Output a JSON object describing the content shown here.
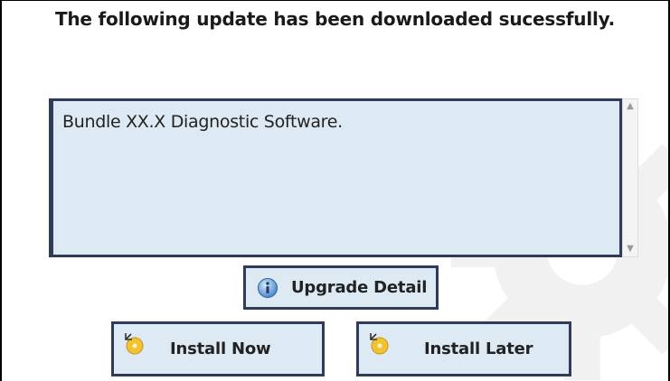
{
  "dialog": {
    "heading": "The following update has been downloaded sucessfully.",
    "update_list": {
      "content": "Bundle XX.X Diagnostic Software."
    },
    "buttons": {
      "upgrade_detail": "Upgrade Detail",
      "install_now": "Install Now",
      "install_later": "Install Later"
    },
    "icons": {
      "upgrade_detail": "info-icon",
      "install_now": "install-disk-icon",
      "install_later": "install-disk-icon",
      "background": "gear-icon"
    },
    "colors": {
      "panel_fill": "#dde9f3",
      "panel_border": "#2e3b59",
      "text": "#222222"
    }
  }
}
